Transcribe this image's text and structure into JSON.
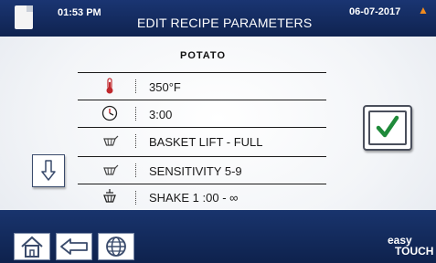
{
  "header": {
    "time": "01:53 PM",
    "title": "EDIT RECIPE PARAMETERS",
    "date": "06-07-2017"
  },
  "recipe": {
    "product": "POTATO",
    "rows": [
      {
        "icon": "thermometer-icon",
        "value": "350°F"
      },
      {
        "icon": "clock-icon",
        "value": "3:00"
      },
      {
        "icon": "basket-icon",
        "value": "BASKET LIFT - FULL"
      },
      {
        "icon": "basket-icon",
        "value": "SENSITIVITY 5-9"
      },
      {
        "icon": "basket-shake-icon",
        "value": "SHAKE 1   :00  - ∞"
      }
    ]
  },
  "brand": {
    "line1": "easy",
    "line2": "TOUCH"
  },
  "colors": {
    "header_bg": "#12295a",
    "footer_bg": "#12295a",
    "check_green": "#1f8a3a",
    "thermometer_red": "#c0282d"
  }
}
